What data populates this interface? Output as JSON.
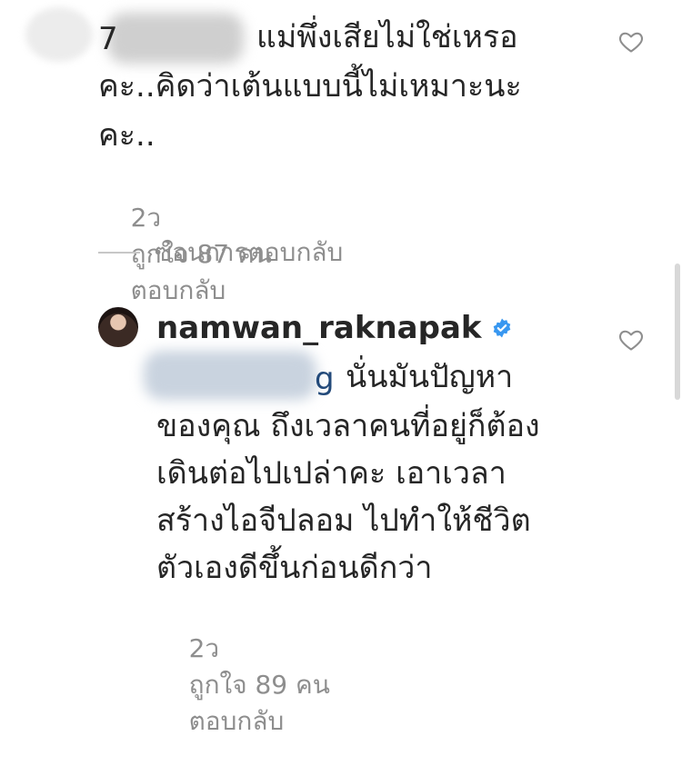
{
  "comment_1": {
    "leading_char": "7",
    "text_lines": [
      "แม่พึ่งเสียไม่ใช่เหรอ",
      "คะ..คิดว่าเต้นแบบนี้ไม่เหมาะนะ",
      "คะ.."
    ],
    "time": "2ว",
    "likes": "ถูกใจ 87 คน",
    "reply": "ตอบกลับ"
  },
  "hide_replies": {
    "label": "ซ่อนการตอบกลับ"
  },
  "reply_1": {
    "username": "namwan_raknapak",
    "mention_tail": "g",
    "text_lines": [
      "นั่นมันปัญหา",
      "ของคุณ ถึงเวลาคนที่อยู่ก็ต้อง",
      "เดินต่อไปเปล่าคะ เอาเวลา",
      "สร้างไอจีปลอม ไปทำให้ชีวิต",
      "ตัวเองดีขึ้นก่อนดีกว่า"
    ],
    "time": "2ว",
    "likes": "ถูกใจ 89 คน",
    "reply": "ตอบกลับ"
  },
  "icons": {
    "heart": "heart-icon",
    "verified": "verified-badge-icon"
  },
  "colors": {
    "text": "#262626",
    "meta": "#8e8e8e",
    "verified": "#3897f0",
    "mention": "#234a7a"
  }
}
